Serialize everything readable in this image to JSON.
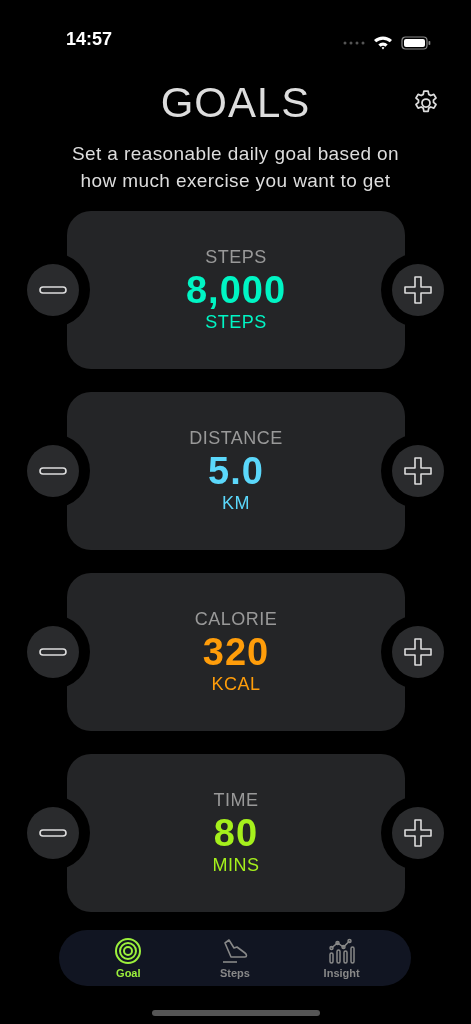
{
  "status_bar": {
    "time": "14:57"
  },
  "header": {
    "title": "GOALS",
    "subtitle": "Set a reasonable daily goal based on how much exercise you want to get"
  },
  "goals": [
    {
      "label": "STEPS",
      "value": "8,000",
      "unit": "STEPS",
      "color": "#00f5c4"
    },
    {
      "label": "DISTANCE",
      "value": "5.0",
      "unit": "KM",
      "color": "#5bd8fb"
    },
    {
      "label": "CALORIE",
      "value": "320",
      "unit": "KCAL",
      "color": "#ff9d0a"
    },
    {
      "label": "TIME",
      "value": "80",
      "unit": "MINS",
      "color": "#a5f01c"
    }
  ],
  "tabs": [
    {
      "label": "Goal",
      "kind": "target",
      "selected": true
    },
    {
      "label": "Steps",
      "kind": "shoe",
      "selected": false
    },
    {
      "label": "Insight",
      "kind": "chart",
      "selected": false
    }
  ]
}
